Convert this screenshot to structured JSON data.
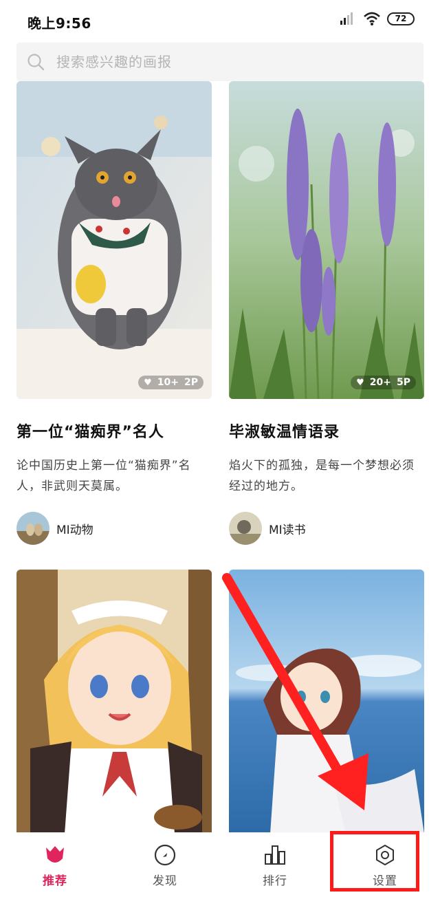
{
  "status_bar": {
    "time": "晚上9:56",
    "battery": "72"
  },
  "search": {
    "placeholder": "搜索感兴趣的画报",
    "icon": "search-icon"
  },
  "cards": [
    {
      "likes": "10+",
      "pages": "2P",
      "title": "第一位“猫痴界”名人",
      "desc": "论中国历史上第一位“猫痴界”名人，非武则天莫属。",
      "author": "MI动物"
    },
    {
      "likes": "20+",
      "pages": "5P",
      "title": "毕淑敏温情语录",
      "desc": "焰火下的孤独，是每一个梦想必须经过的地方。",
      "author": "MI读书"
    }
  ],
  "nav": {
    "items": [
      {
        "label": "推荐",
        "icon": "tulip-icon",
        "active": true
      },
      {
        "label": "发现",
        "icon": "compass-icon",
        "active": false
      },
      {
        "label": "排行",
        "icon": "bar-chart-icon",
        "active": false
      },
      {
        "label": "设置",
        "icon": "gear-icon",
        "active": false
      }
    ]
  },
  "colors": {
    "accent": "#e0245e",
    "highlight": "#ff1a1a"
  }
}
